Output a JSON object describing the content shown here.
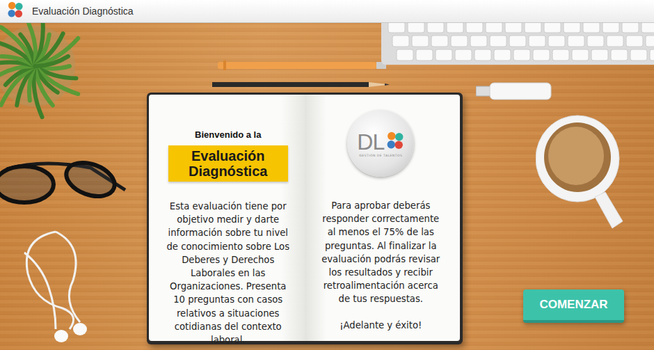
{
  "window": {
    "title": "Evaluación Diagnóstica"
  },
  "welcome": {
    "intro": "Bienvenido a la",
    "heading_line1": "Evaluación",
    "heading_line2": "Diagnóstica"
  },
  "description": "Esta evaluación tiene por objetivo medir y darte información sobre tu nivel de conocimiento sobre Los Deberes y Derechos Laborales en las Organizaciones. Presenta 10 preguntas con casos relativos a situaciones cotidianas del contexto laboral.",
  "logo": {
    "text": "DL",
    "tagline": "GESTIÓN DE TALENTOS"
  },
  "instructions": "Para aprobar deberás responder correctamente al menos el 75% de las preguntas. Al finalizar la evaluación podrás revisar los resultados y recibir retroalimentación acerca de tus respuestas.",
  "closing": "¡Adelante y éxito!",
  "buttons": [
    {
      "label": "COMENZAR"
    }
  ]
}
